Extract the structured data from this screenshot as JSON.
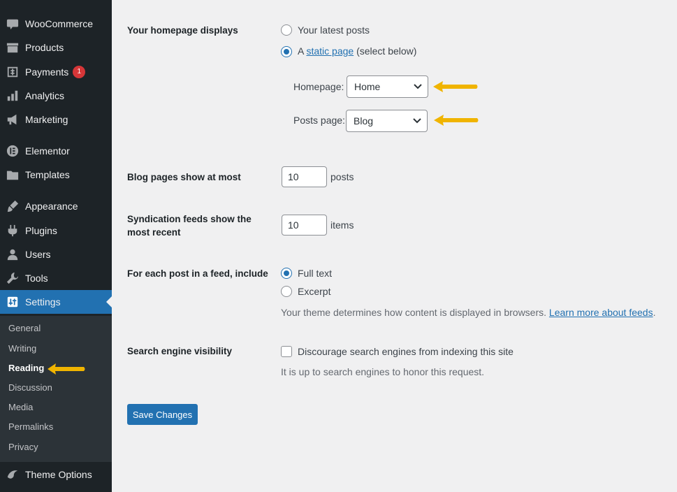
{
  "sidebar": {
    "items": [
      {
        "label": "WooCommerce",
        "icon": "woo-icon"
      },
      {
        "label": "Products",
        "icon": "archive-icon"
      },
      {
        "label": "Payments",
        "icon": "dollar-icon",
        "badge": "1"
      },
      {
        "label": "Analytics",
        "icon": "bar-chart-icon"
      },
      {
        "label": "Marketing",
        "icon": "megaphone-icon"
      },
      {
        "label": "Elementor",
        "icon": "elementor-icon"
      },
      {
        "label": "Templates",
        "icon": "folder-icon"
      },
      {
        "label": "Appearance",
        "icon": "paintbrush-icon"
      },
      {
        "label": "Plugins",
        "icon": "plugin-icon"
      },
      {
        "label": "Users",
        "icon": "user-icon"
      },
      {
        "label": "Tools",
        "icon": "wrench-icon"
      },
      {
        "label": "Settings",
        "icon": "settings-icon"
      },
      {
        "label": "Theme Options",
        "icon": "theme-icon"
      }
    ],
    "submenu": [
      "General",
      "Writing",
      "Reading",
      "Discussion",
      "Media",
      "Permalinks",
      "Privacy"
    ]
  },
  "form": {
    "homepage_displays": {
      "label": "Your homepage displays",
      "option_latest": "Your latest posts",
      "option_static_prefix": "A",
      "option_static_link": "static page",
      "option_static_suffix": "(select below)",
      "homepage_label": "Homepage:",
      "homepage_value": "Home",
      "postspage_label": "Posts page:",
      "postspage_value": "Blog"
    },
    "blog_pages": {
      "label": "Blog pages show at most",
      "value": "10",
      "unit": "posts"
    },
    "syndication": {
      "label": "Syndication feeds show the most recent",
      "value": "10",
      "unit": "items"
    },
    "feed_include": {
      "label": "For each post in a feed, include",
      "option_full": "Full text",
      "option_excerpt": "Excerpt",
      "desc_prefix": "Your theme determines how content is displayed in browsers.",
      "desc_link": "Learn more about feeds",
      "desc_suffix": "."
    },
    "search_visibility": {
      "label": "Search engine visibility",
      "checkbox_label": "Discourage search engines from indexing this site",
      "desc": "It is up to search engines to honor this request."
    },
    "save_label": "Save Changes"
  },
  "colors": {
    "sidebar_bg": "#1d2327",
    "accent": "#2271b1",
    "annotation_arrow": "#f0b400"
  }
}
